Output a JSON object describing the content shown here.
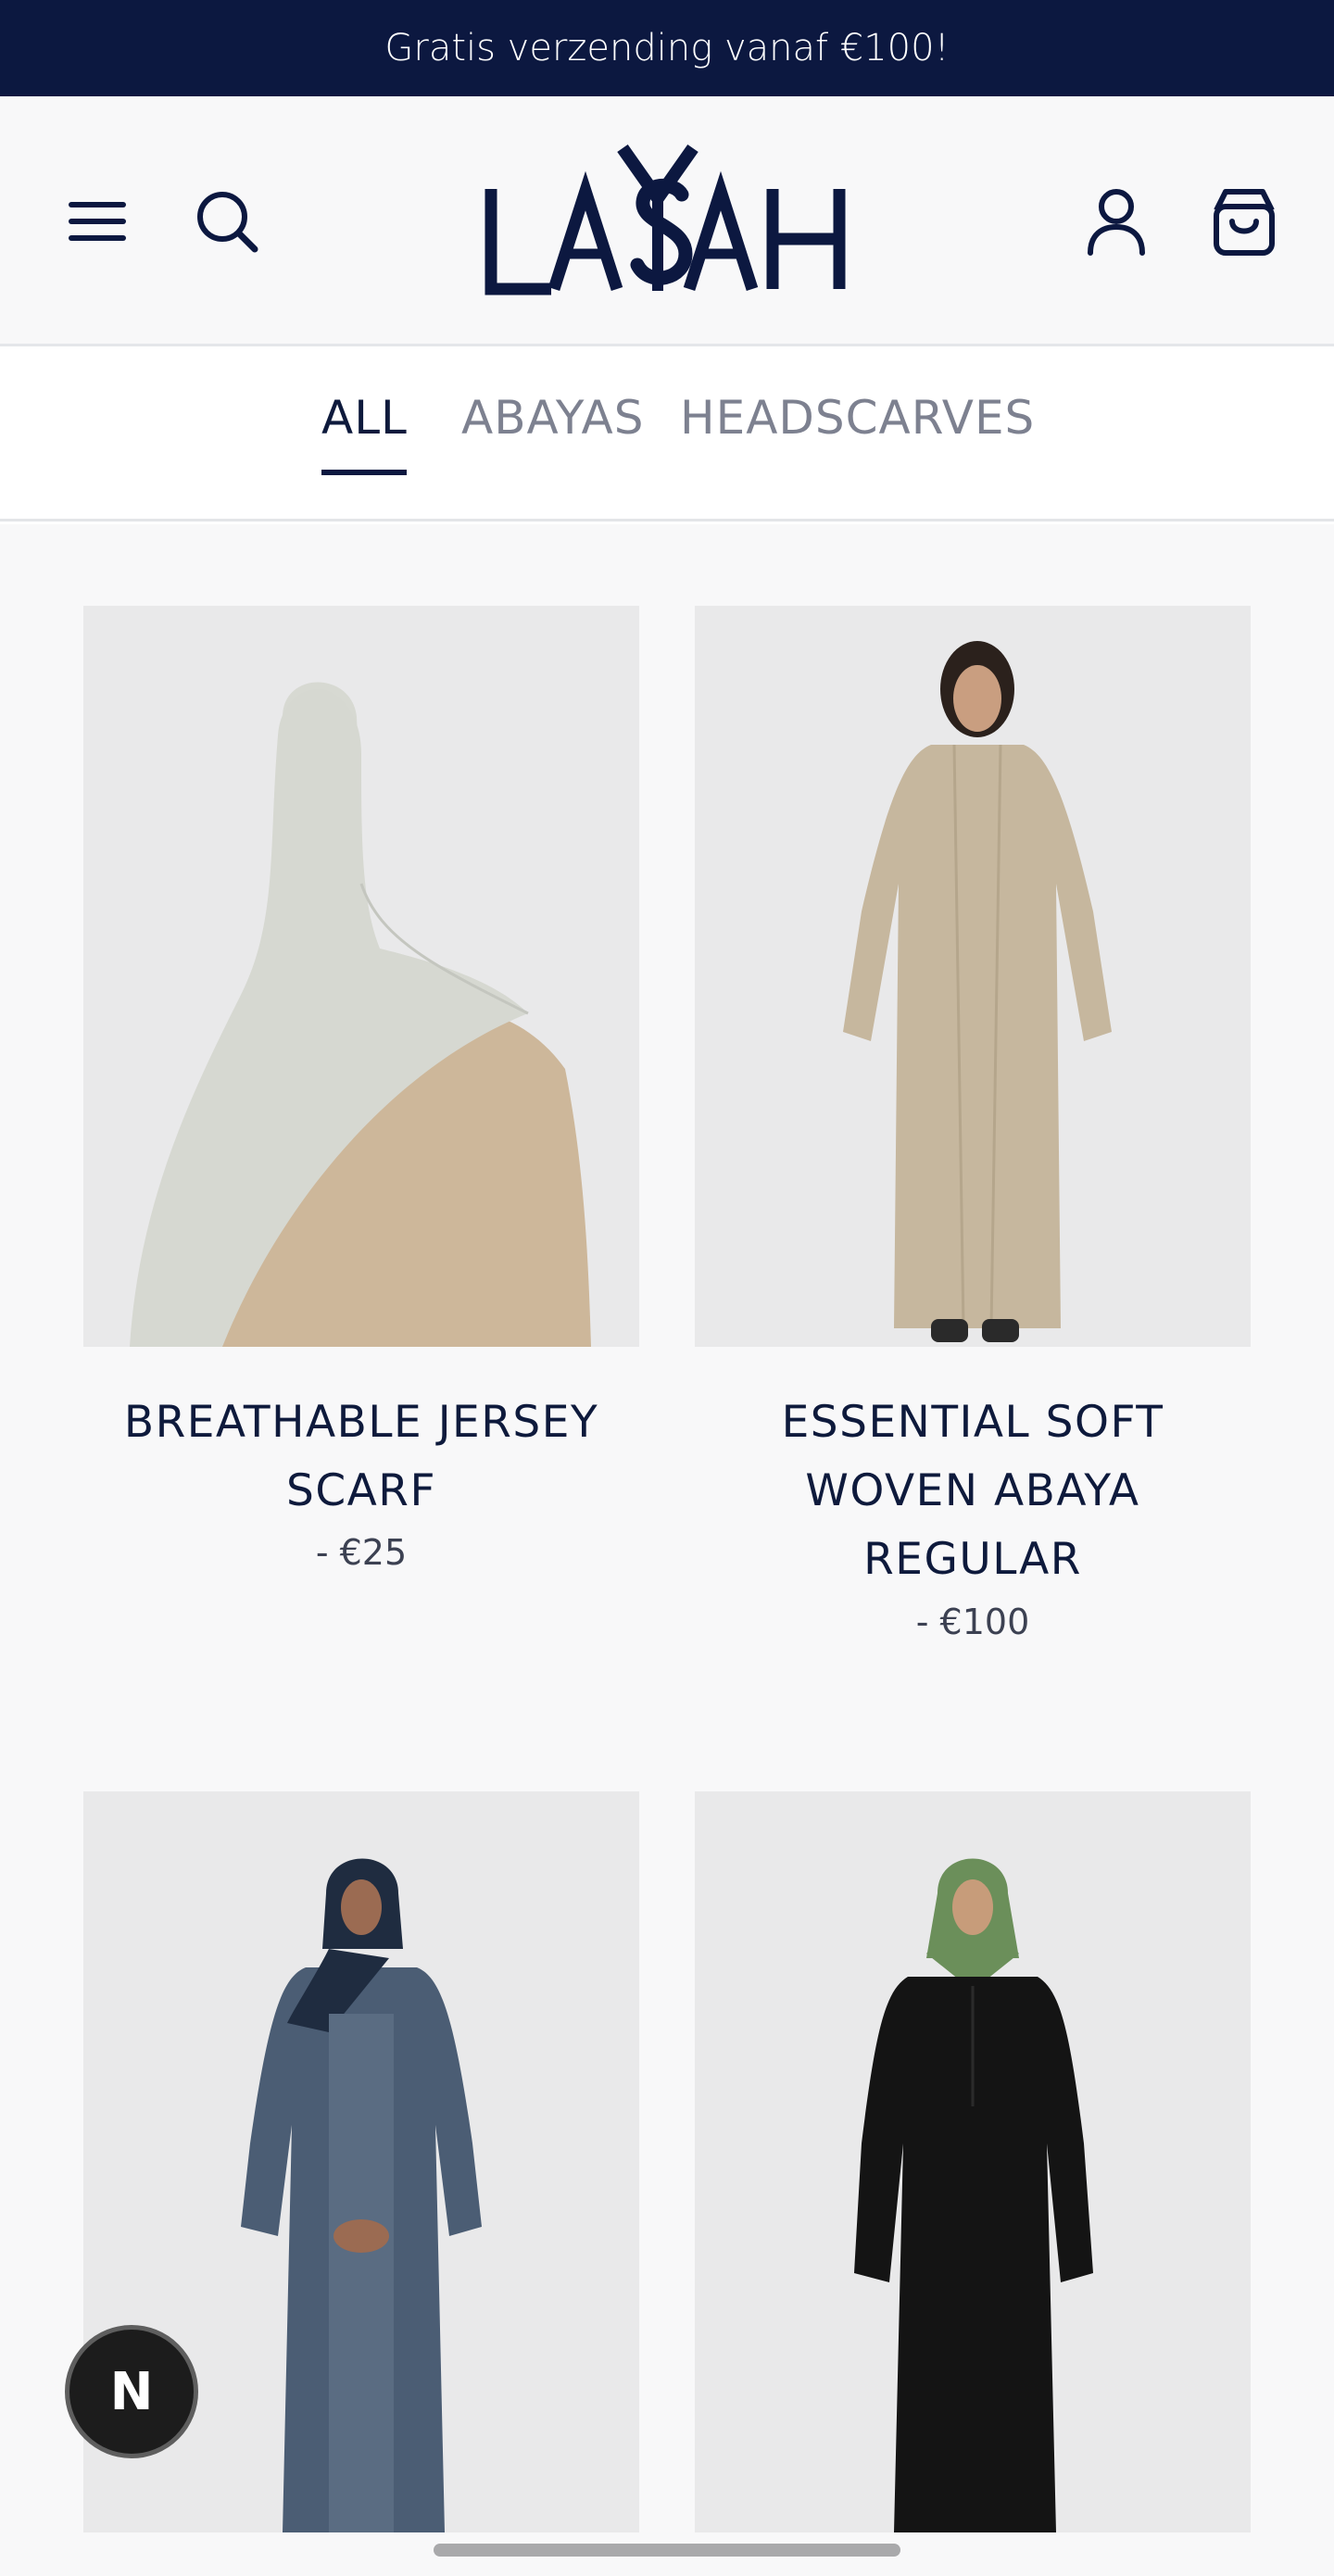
{
  "announcement": {
    "text": "Gratis verzending vanaf €100!"
  },
  "header": {
    "logo_text": "LAYSAH",
    "menu_icon": "hamburger-menu-icon",
    "search_icon": "search-icon",
    "account_icon": "user-icon",
    "cart_icon": "shopping-bag-icon"
  },
  "categories": {
    "tabs": [
      {
        "label": "ALL",
        "active": true
      },
      {
        "label": "ABAYAS",
        "active": false
      },
      {
        "label": "HEADSCARVES",
        "active": false
      }
    ]
  },
  "products": [
    {
      "title_lines": [
        "BREATHABLE JERSEY",
        "SCARF"
      ],
      "price": "- €25"
    },
    {
      "title_lines": [
        "ESSENTIAL SOFT",
        "WOVEN ABAYA",
        "REGULAR"
      ],
      "price": "- €100"
    },
    {
      "title_lines": [],
      "price": ""
    },
    {
      "title_lines": [],
      "price": ""
    }
  ],
  "fab": {
    "label": "N"
  },
  "colors": {
    "brand_navy": "#0c1840",
    "text_navy": "#0e1a3c",
    "muted_tab": "#7d8190",
    "image_bg": "#e9e9ea"
  }
}
